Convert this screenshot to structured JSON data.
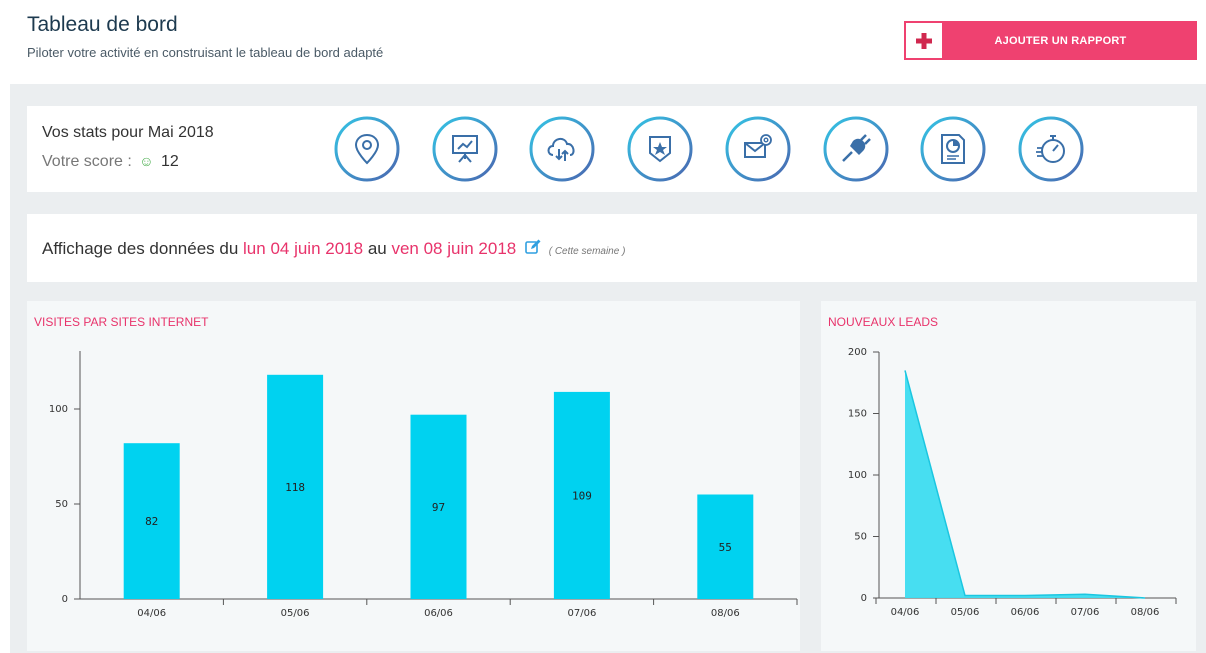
{
  "header": {
    "title": "Tableau de bord",
    "subtitle": "Piloter votre activité en construisant le tableau de bord adapté",
    "add_button_label": "AJOUTER UN RAPPORT"
  },
  "stats": {
    "title": "Vos stats pour Mai 2018",
    "score_label": "Votre score :",
    "score_value": "12",
    "icons": [
      "location-pin-icon",
      "presentation-board-icon",
      "cloud-sync-icon",
      "badge-star-icon",
      "email-at-icon",
      "plug-icon",
      "report-chart-icon",
      "stopwatch-icon"
    ]
  },
  "period": {
    "prefix": "Affichage des données du",
    "start": "lun 04 juin 2018",
    "middle": "au",
    "end": "ven 08 juin 2018",
    "note": "( Cette semaine )"
  },
  "colors": {
    "accent": "#ef4170",
    "bar": "#00d2f0",
    "area": "#3ddcf0",
    "title": "#1d3a4f"
  },
  "chart_data": [
    {
      "type": "bar",
      "title": "VISITES PAR SITES INTERNET",
      "categories": [
        "04/06",
        "05/06",
        "06/06",
        "07/06",
        "08/06"
      ],
      "values": [
        82,
        118,
        97,
        109,
        55
      ],
      "yticks": [
        0,
        50,
        100
      ],
      "ylim": [
        0,
        130
      ],
      "xlabel": "",
      "ylabel": ""
    },
    {
      "type": "area",
      "title": "NOUVEAUX LEADS",
      "categories": [
        "04/06",
        "05/06",
        "06/06",
        "07/06",
        "08/06"
      ],
      "values": [
        185,
        2,
        2,
        3,
        0
      ],
      "yticks": [
        0,
        50,
        100,
        150,
        200
      ],
      "ylim": [
        0,
        200
      ],
      "xlabel": "",
      "ylabel": ""
    }
  ]
}
